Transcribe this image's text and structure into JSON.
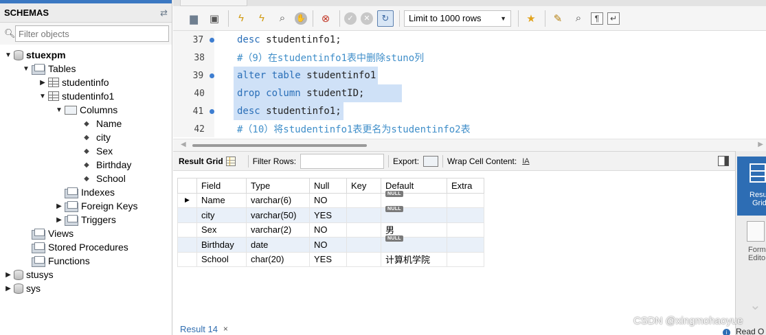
{
  "navigator": {
    "header_title": "SCHEMAS",
    "filter_placeholder": "Filter objects",
    "tree": [
      {
        "label": "stuexpm",
        "level": 0,
        "expander": "▼",
        "icon": "database-icon",
        "bold": true
      },
      {
        "label": "Tables",
        "level": 1,
        "expander": "▼",
        "icon": "folder-icon"
      },
      {
        "label": "studentinfo",
        "level": 2,
        "expander": "▶",
        "icon": "table-icon"
      },
      {
        "label": "studentinfo1",
        "level": 2,
        "expander": "▼",
        "icon": "table-icon"
      },
      {
        "label": "Columns",
        "level": 3,
        "expander": "▼",
        "icon": "columns-icon"
      },
      {
        "label": "Name",
        "level": 4,
        "expander": "",
        "icon": "column-icon"
      },
      {
        "label": "city",
        "level": 4,
        "expander": "",
        "icon": "column-icon"
      },
      {
        "label": "Sex",
        "level": 4,
        "expander": "",
        "icon": "column-icon"
      },
      {
        "label": "Birthday",
        "level": 4,
        "expander": "",
        "icon": "column-icon"
      },
      {
        "label": "School",
        "level": 4,
        "expander": "",
        "icon": "column-icon"
      },
      {
        "label": "Indexes",
        "level": 3,
        "expander": "",
        "icon": "folder-icon"
      },
      {
        "label": "Foreign Keys",
        "level": 3,
        "expander": "▶",
        "icon": "folder-icon"
      },
      {
        "label": "Triggers",
        "level": 3,
        "expander": "▶",
        "icon": "folder-icon"
      },
      {
        "label": "Views",
        "level": 1,
        "expander": "",
        "icon": "folder-icon"
      },
      {
        "label": "Stored Procedures",
        "level": 1,
        "expander": "",
        "icon": "folder-icon"
      },
      {
        "label": "Functions",
        "level": 1,
        "expander": "",
        "icon": "folder-icon"
      },
      {
        "label": "stusys",
        "level": 0,
        "expander": "▶",
        "icon": "database-icon"
      },
      {
        "label": "sys",
        "level": 0,
        "expander": "▶",
        "icon": "database-icon"
      }
    ]
  },
  "toolbar": {
    "limit_label": "Limit to 1000 rows",
    "icons": [
      "open-file-icon",
      "save-icon",
      "execute-icon",
      "execute-statement-icon",
      "explain-icon",
      "stop-icon",
      "toggle-error-icon",
      "commit-icon",
      "rollback-icon",
      "autocommit-icon",
      "beautify-icon",
      "brush-icon",
      "find-icon",
      "invisible-chars-icon",
      "wrap-icon"
    ]
  },
  "editor": {
    "lines": [
      {
        "num": "37",
        "marker": true,
        "text": "desc studentinfo1;"
      },
      {
        "num": "38",
        "marker": false,
        "text": "#（9）在studentinfo1表中删除stuno列"
      },
      {
        "num": "39",
        "marker": true,
        "text": "alter table studentinfo1"
      },
      {
        "num": "40",
        "marker": false,
        "text": "    drop column studentID;"
      },
      {
        "num": "41",
        "marker": true,
        "text": "desc studentinfo1;"
      },
      {
        "num": "42",
        "marker": false,
        "text": "#（10）将studentinfo1表更名为studentinfo2表"
      }
    ]
  },
  "result": {
    "toolbar": {
      "grid_label": "Result Grid",
      "filter_rows_label": "Filter Rows:",
      "export_label": "Export:",
      "wrap_label": "Wrap Cell Content:"
    },
    "columns": [
      "Field",
      "Type",
      "Null",
      "Key",
      "Default",
      "Extra"
    ],
    "rows": [
      {
        "Field": "Name",
        "Type": "varchar(6)",
        "Null": "NO",
        "Key": "",
        "Default": "NULL",
        "Extra": "",
        "default_is_null": true
      },
      {
        "Field": "city",
        "Type": "varchar(50)",
        "Null": "YES",
        "Key": "",
        "Default": "NULL",
        "Extra": "",
        "default_is_null": true
      },
      {
        "Field": "Sex",
        "Type": "varchar(2)",
        "Null": "NO",
        "Key": "",
        "Default": "男",
        "Extra": "",
        "default_is_null": false
      },
      {
        "Field": "Birthday",
        "Type": "date",
        "Null": "NO",
        "Key": "",
        "Default": "NULL",
        "Extra": "",
        "default_is_null": true
      },
      {
        "Field": "School",
        "Type": "char(20)",
        "Null": "YES",
        "Key": "",
        "Default": "计算机学院",
        "Extra": "",
        "default_is_null": false
      }
    ],
    "tab_label": "Result 14",
    "tab_close": "×"
  },
  "side_panel": {
    "result_grid_line1": "Resu",
    "result_grid_line2": "Grid",
    "form_editor_line1": "Form",
    "form_editor_line2": "Edito"
  },
  "status": {
    "read_label": "Read O"
  },
  "watermark": "CSDN @xingmohaoyue",
  "colors": {
    "accent": "#2d6db4",
    "keyword": "#2a6fb8",
    "selection": "#cfe1f7",
    "alt_row": "#e9f0f9"
  }
}
